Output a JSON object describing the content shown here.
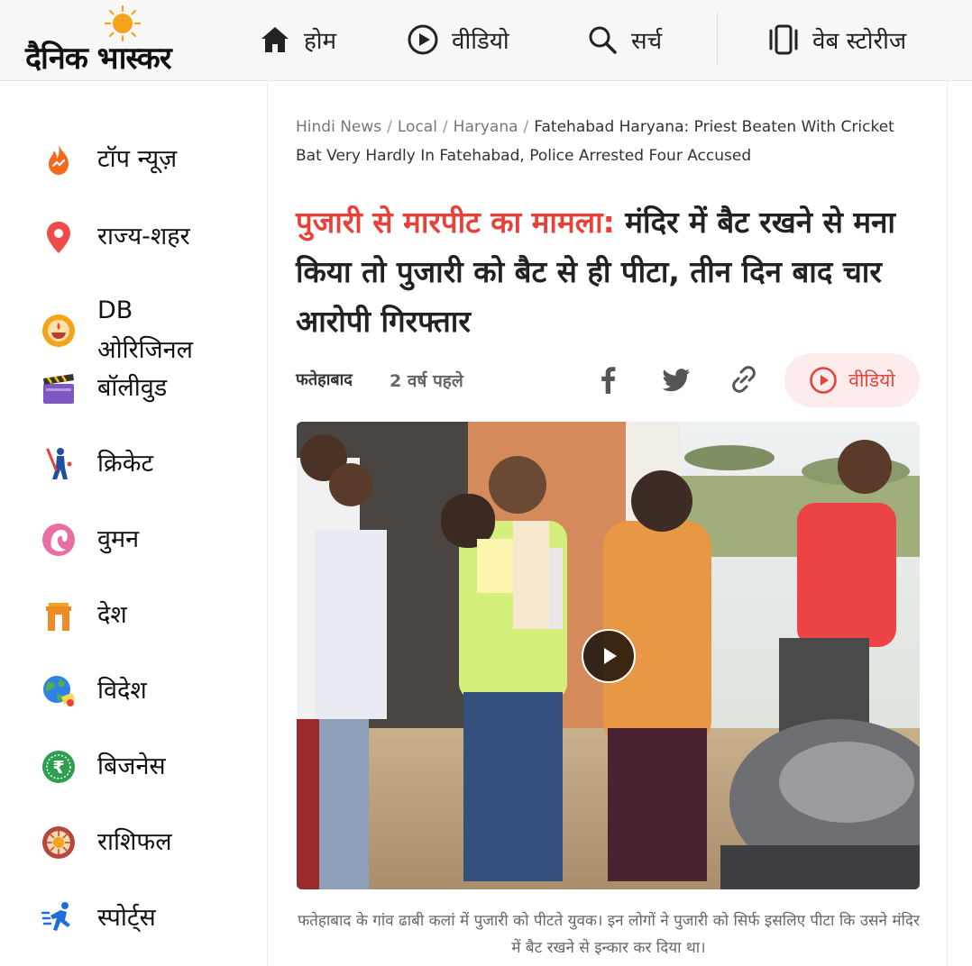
{
  "logo": {
    "text": "दैनिक भास्कर"
  },
  "nav": {
    "home": "होम",
    "video": "वीडियो",
    "search": "सर्च",
    "webstories": "वेब स्टोरीज"
  },
  "sidebar": {
    "items": [
      {
        "label": "टॉप न्यूज़",
        "icon": "fire-icon"
      },
      {
        "label": "राज्य-शहर",
        "icon": "location-pin-icon"
      },
      {
        "label": "DB ओरिजिनल",
        "icon": "diya-lamp-icon"
      },
      {
        "label": "बॉलीवुड",
        "icon": "clapperboard-icon"
      },
      {
        "label": "क्रिकेट",
        "icon": "cricket-player-icon"
      },
      {
        "label": "वुमन",
        "icon": "woman-face-icon"
      },
      {
        "label": "देश",
        "icon": "india-gate-icon"
      },
      {
        "label": "विदेश",
        "icon": "globe-icon"
      },
      {
        "label": "बिजनेस",
        "icon": "rupee-icon"
      },
      {
        "label": "राशिफल",
        "icon": "zodiac-wheel-icon"
      },
      {
        "label": "स्पोर्ट्स",
        "icon": "runner-icon"
      }
    ]
  },
  "breadcrumb": {
    "items": [
      "Hindi News",
      "Local",
      "Haryana"
    ],
    "current": "Fatehabad Haryana: Priest Beaten With Cricket Bat Very Hardly In Fatehabad, Police Arrested Four Accused"
  },
  "article": {
    "headline_highlight": "पुजारी से मारपीट का मामला:",
    "headline_rest": " मंदिर में बैट रखने से मना किया तो पुजारी को बैट से ही पीटा, तीन दिन बाद चार आरोपी गिरफ्तार",
    "location": "फतेहाबाद",
    "time": "2 वर्ष पहले",
    "video_label": "वीडियो",
    "caption": "फतेहाबाद के गांव ढाबी कलां में पुजारी को पीटते युवक। इन लोगों ने पुजारी को सिर्फ इसलिए पीटा कि उसने मंदिर में बैट रखने से इन्कार कर दिया था।"
  },
  "colors": {
    "accent": "#e8413a",
    "brand_sun": "#f5a31a"
  }
}
